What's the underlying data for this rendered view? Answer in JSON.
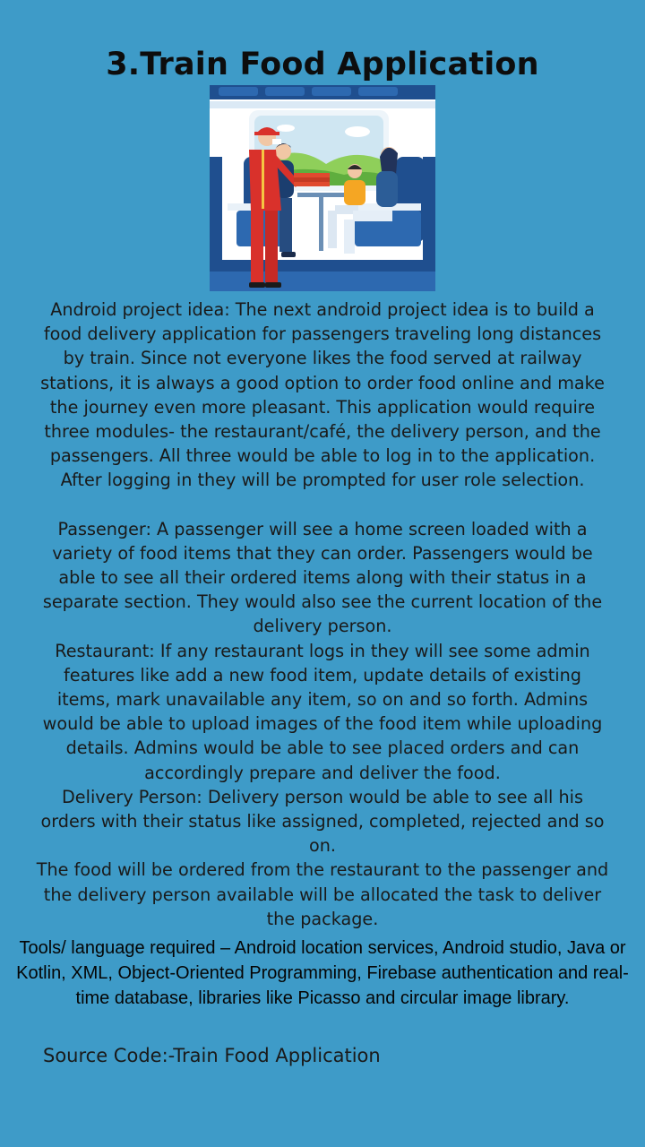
{
  "title": "3.Train Food Application",
  "illustration": {
    "icon": "train-food-delivery-illustration",
    "colors": {
      "sky": "#cfe6f2",
      "seat": "#1f4f8f",
      "uniform": "#d9312b",
      "hill": "#8fcf5a"
    }
  },
  "description": {
    "intro": "Android project idea: The next android project idea is to build a food delivery application for passengers traveling long distances by train. Since not everyone likes the food served at railway stations, it is always a good option to order food online and make the journey even more pleasant. This application would require three modules- the restaurant/café, the delivery person, and the passengers. All three would be able to log in to the application. After logging in they will be prompted for user role selection.",
    "passenger": "Passenger: A passenger will see a home screen loaded with a variety of food items that they can order. Passengers would be able to see all their ordered items along with their status in a separate section. They would also see the current location of the delivery person.",
    "restaurant": "Restaurant:  If any restaurant logs in they will see some admin features like add a new food item, update details of existing items, mark unavailable any item, so on and so forth. Admins would be able to upload images of the food item while uploading details. Admins would be able to see placed orders and can accordingly prepare and deliver the food.",
    "delivery": "Delivery Person: Delivery person would be able to see all his orders with their status like assigned, completed, rejected and so on.",
    "flow": "The food will be ordered from the restaurant to the passenger and the delivery person available will be allocated the task to deliver the package."
  },
  "tools": "Tools/ language required – Android location services, Android studio, Java or Kotlin, XML, Object-Oriented Programming, Firebase authentication and real-time database, libraries like Picasso and circular image library.",
  "source": "Source Code:-Train Food Application",
  "colors": {
    "background": "#3e9bc8",
    "text": "#1a1a1a"
  }
}
